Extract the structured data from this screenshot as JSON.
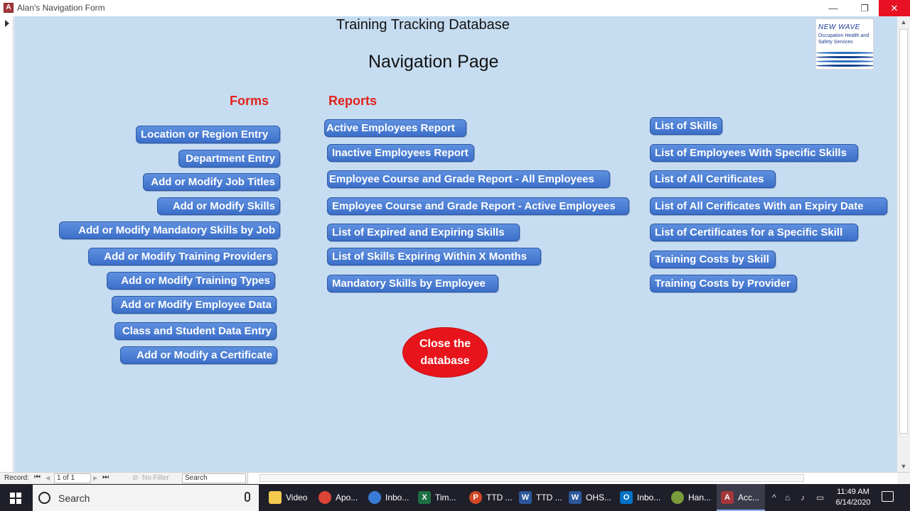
{
  "window": {
    "title": "Alan's Navigation Form",
    "minimize_glyph": "—",
    "restore_glyph": "❐",
    "close_glyph": "✕",
    "app_icon_letter": "A"
  },
  "form": {
    "db_title": "Training Tracking Database",
    "page_title": "Navigation Page",
    "forms_label": "Forms",
    "reports_label": "Reports",
    "logo": {
      "brand": "NEW WAVE",
      "tagline": "Occupation Health and Safety Services"
    },
    "forms_buttons": [
      "Location or Region Entry",
      "Department Entry",
      "Add or Modify Job Titles",
      "Add or Modify Skills",
      "Add or Modify Mandatory Skills by Job",
      "Add or Modify Training Providers",
      "Add or Modify Training Types",
      "Add or Modify Employee Data",
      "Class and Student Data Entry",
      "Add or Modify a Certificate"
    ],
    "report_buttons": [
      "Active Employees  Report",
      "Inactive Employees Report",
      "Employee Course and Grade Report - All Employees",
      "Employee Course and Grade Report - Active Employees",
      "List of Expired and Expiring Skills",
      "List of Skills Expiring Within X Months",
      "Mandatory Skills by Employee"
    ],
    "list_buttons": [
      "List of Skills",
      "List of Employees With Specific Skills",
      "List of All Certificates",
      "List of All Cerificates With an Expiry Date",
      "List of Certificates for a Specific Skill",
      "Training Costs by Skill",
      "Training Costs by Provider"
    ],
    "close_button": {
      "line1": "Close the",
      "line2": "database"
    },
    "colors": {
      "background": "#c6dcf1",
      "button": "#4a7fd4",
      "section_label": "#e2231a",
      "close_button": "#e8141b"
    }
  },
  "record_bar": {
    "record_label": "Record:",
    "first": "⏮",
    "prev": "◀",
    "position": "1 of 1",
    "next": "▶",
    "last": "⏭",
    "filter": "No Filter",
    "search_placeholder": "Search"
  },
  "taskbar": {
    "search_placeholder": "Search",
    "apps": [
      {
        "label": "Video",
        "icon": "folder-icon",
        "color": "#f2c94c"
      },
      {
        "label": "Apo...",
        "icon": "chrome-icon",
        "color": "#db4437"
      },
      {
        "label": "Inbo...",
        "icon": "thunderbird-icon",
        "color": "#3a7bd5"
      },
      {
        "label": "Tim...",
        "icon": "excel-icon",
        "color": "#1d6f42"
      },
      {
        "label": "TTD ...",
        "icon": "powerpoint-icon",
        "color": "#d24726"
      },
      {
        "label": "TTD ...",
        "icon": "word-icon",
        "color": "#2b579a"
      },
      {
        "label": "OHS...",
        "icon": "word-icon",
        "color": "#2b579a"
      },
      {
        "label": "Inbo...",
        "icon": "outlook-icon",
        "color": "#0072c6"
      },
      {
        "label": "Han...",
        "icon": "paint-icon",
        "color": "#7a9b3a"
      },
      {
        "label": "Acc...",
        "icon": "access-icon",
        "color": "#a4373a"
      }
    ],
    "app_letters": [
      "",
      "",
      "",
      "X",
      "P",
      "W",
      "W",
      "O",
      "",
      "A"
    ],
    "tray_chevron": "^",
    "time": "11:49 AM",
    "date": "6/14/2020"
  }
}
